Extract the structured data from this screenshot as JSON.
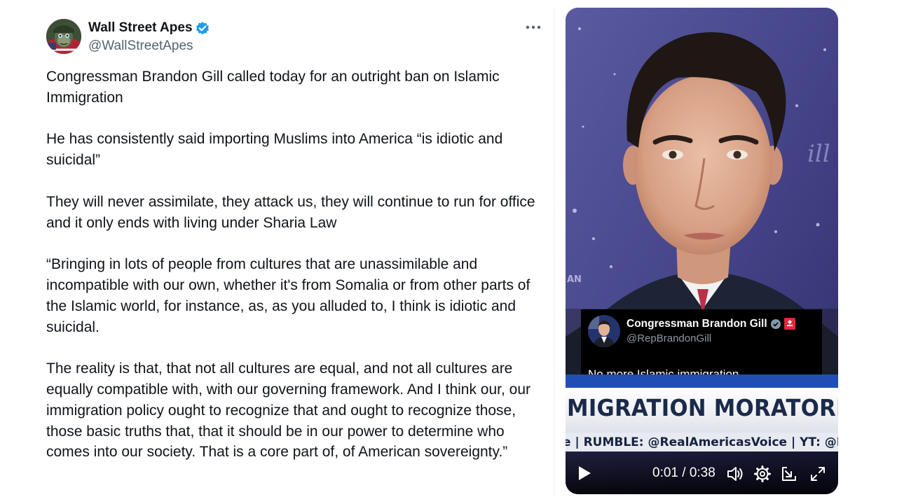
{
  "author": {
    "name": "Wall Street Apes",
    "handle": "@WallStreetApes",
    "verified": true,
    "verified_color": "#1d9bf0"
  },
  "tweet": {
    "paragraphs": [
      "Congressman Brandon Gill called today for an outright ban on Islamic Immigration",
      "He has consistently said importing Muslims into America “is idiotic and suicidal”",
      "They will never assimilate, they attack us, they will continue to run for office and it only ends with living under Sharia Law",
      "“Bringing in lots of people from cultures that are unassimilable and incompatible with our own, whether it's from Somalia or from other parts of the Islamic world, for instance, as, as you alluded to, I think is idiotic and suicidal.",
      "The reality is that, that not all cultures are equal, and not all cultures are equally compatible with, with our governing framework. And I think our, our immigration policy ought to recognize that and ought to recognize those, those basic truths that, that it should be in our power to determine who comes into our society. That is a core part of, of American sovereignty.”"
    ]
  },
  "video": {
    "inset_post": {
      "name": "Congressman Brandon Gill",
      "handle": "@RepBrandonGill",
      "text": "No more Islamic immigration."
    },
    "banner_headline": "MIGRATION MORATORIU",
    "ticker": "e | RUMBLE: @RealAmericasVoice | YT: @I",
    "time": "0:01 / 0:38",
    "duration_seconds": 38,
    "position_seconds": 1
  },
  "icons": {
    "more": "more-horizontal-icon",
    "verified": "verified-badge-icon",
    "play": "play-icon",
    "volume": "volume-icon",
    "settings": "gear-icon",
    "popout": "popout-icon",
    "fullscreen": "fullscreen-icon"
  }
}
